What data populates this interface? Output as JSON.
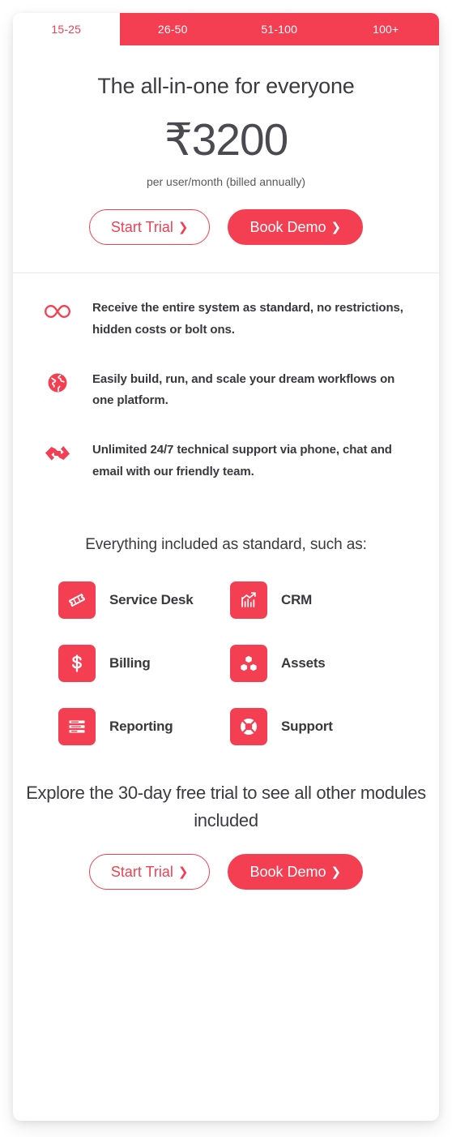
{
  "tabs": [
    {
      "label": "15-25",
      "active": true
    },
    {
      "label": "26-50",
      "active": false
    },
    {
      "label": "51-100",
      "active": false
    },
    {
      "label": "100+",
      "active": false
    }
  ],
  "hero": {
    "title": "The all-in-one for everyone",
    "price": "₹3200",
    "price_note": "per user/month (billed annually)",
    "primary_cta": "Book Demo",
    "secondary_cta": "Start Trial",
    "chevron": "❯"
  },
  "features": [
    {
      "icon": "infinity-icon",
      "text": "Receive the entire system as standard, no restrictions, hidden costs or bolt ons."
    },
    {
      "icon": "globe-icon",
      "text": "Easily build, run, and scale your dream workflows on one platform."
    },
    {
      "icon": "handshake-icon",
      "text": "Unlimited 24/7 technical support via phone, chat and email with our friendly team."
    }
  ],
  "modules_heading": "Everything included as standard, such as:",
  "modules": [
    {
      "label": "Service Desk",
      "icon": "ticket-icon"
    },
    {
      "label": "CRM",
      "icon": "chart-arrow-icon"
    },
    {
      "label": "Billing",
      "icon": "dollar-icon"
    },
    {
      "label": "Assets",
      "icon": "boxes-icon"
    },
    {
      "label": "Reporting",
      "icon": "report-list-icon"
    },
    {
      "label": "Support",
      "icon": "lifebuoy-icon"
    }
  ],
  "cta": {
    "text": "Explore the 30-day free trial to see all other modules included",
    "primary_cta": "Book Demo",
    "secondary_cta": "Start Trial",
    "chevron": "❯"
  },
  "colors": {
    "accent": "#F43F52",
    "text_dark": "#38383D",
    "card_bg": "#FFFFFF",
    "divider": "#E9E9EC"
  }
}
